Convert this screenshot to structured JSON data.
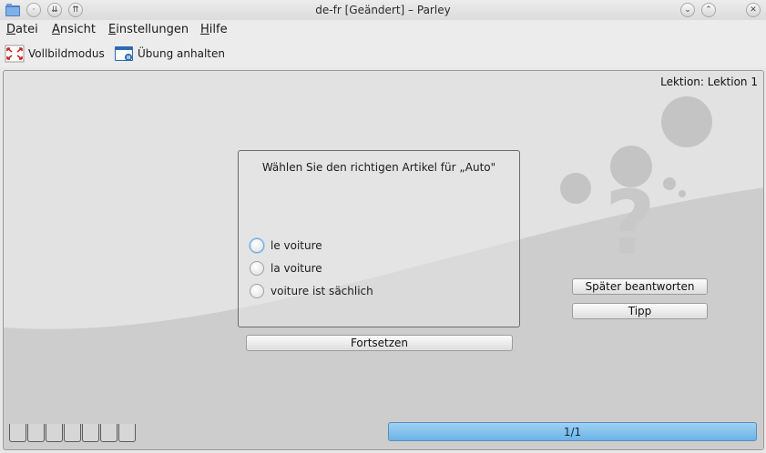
{
  "window": {
    "title": "de-fr [Geändert] – Parley"
  },
  "menu": {
    "items": [
      {
        "label": "Datei",
        "mnemonic": "D"
      },
      {
        "label": "Ansicht",
        "mnemonic": "A"
      },
      {
        "label": "Einstellungen",
        "mnemonic": "E"
      },
      {
        "label": "Hilfe",
        "mnemonic": "H"
      }
    ]
  },
  "toolbar": {
    "fullscreen_label": "Vollbildmodus",
    "pause_label": "Übung anhalten"
  },
  "practice": {
    "lesson_label": "Lektion: Lektion 1",
    "question": "Wählen Sie den richtigen Artikel für „Auto\"",
    "options": [
      {
        "label": "le voiture",
        "selected": false
      },
      {
        "label": "la voiture",
        "selected": false
      },
      {
        "label": "voiture ist sächlich",
        "selected": false
      }
    ],
    "continue_label": "Fortsetzen",
    "later_label": "Später beantworten",
    "hint_label": "Tipp",
    "progress_text": "1/1",
    "progress_fraction": 1.0,
    "leitner_boxes": 7
  },
  "colors": {
    "progress_fill": "#6bb4e8",
    "focus_ring": "#6aa7dd"
  },
  "icons": {
    "app": "folder-icon",
    "fullscreen": "fullscreen-icon",
    "pause": "pause-practice-icon",
    "decoration": "question-mark-bubbles-icon"
  }
}
